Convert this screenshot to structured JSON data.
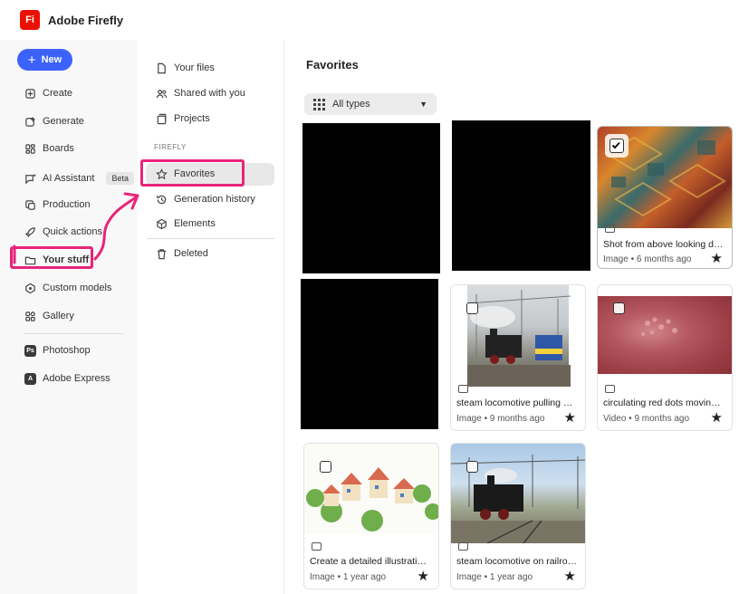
{
  "app": {
    "logo_text": "Fi",
    "title": "Adobe Firefly",
    "brand_color": "#eb1000",
    "accent": "#3b63fb",
    "annotation_color": "#e8247a"
  },
  "rail": {
    "new_label": "New",
    "items": [
      {
        "label": "Create",
        "icon": "create-icon"
      },
      {
        "label": "Generate",
        "icon": "generate-icon"
      },
      {
        "label": "Boards",
        "icon": "boards-icon"
      },
      {
        "label": "AI Assistant",
        "icon": "assistant-icon",
        "badge": "Beta"
      },
      {
        "label": "Production",
        "icon": "production-icon"
      },
      {
        "label": "Quick actions",
        "icon": "rocket-icon"
      },
      {
        "label": "Your stuff",
        "icon": "folder-icon"
      },
      {
        "label": "Custom models",
        "icon": "models-icon"
      },
      {
        "label": "Gallery",
        "icon": "gallery-icon"
      }
    ],
    "apps": [
      {
        "label": "Photoshop",
        "icon_text": "Ps"
      },
      {
        "label": "Adobe Express",
        "icon_text": "A"
      }
    ]
  },
  "subnav": {
    "items": [
      {
        "label": "Your files",
        "icon": "file-icon"
      },
      {
        "label": "Shared with you",
        "icon": "people-icon"
      },
      {
        "label": "Projects",
        "icon": "projects-icon"
      }
    ],
    "section": "FIREFLY",
    "firefly_items": [
      {
        "label": "Favorites",
        "icon": "star-icon"
      },
      {
        "label": "Generation history",
        "icon": "history-icon"
      },
      {
        "label": "Elements",
        "icon": "elements-icon"
      }
    ],
    "deleted": {
      "label": "Deleted",
      "icon": "trash-icon"
    }
  },
  "main": {
    "title": "Favorites",
    "filter_label": "All types",
    "cards": [
      {
        "title": "Shot from above looking do...",
        "meta": "Image • 6 months ago",
        "type": "image",
        "checked": true
      },
      {
        "title": "steam locomotive pulling pa...",
        "meta": "Image • 9 months ago",
        "type": "image",
        "checked": false
      },
      {
        "title": "circulating red dots moving a...",
        "meta": "Video • 9 months ago",
        "type": "video",
        "checked": false
      },
      {
        "title": "Create a detailed illustration ...",
        "meta": "Image • 1 year ago",
        "type": "image",
        "checked": false
      },
      {
        "title": "steam locomotive on railroa...",
        "meta": "Image • 1 year ago",
        "type": "image",
        "checked": false
      }
    ]
  }
}
